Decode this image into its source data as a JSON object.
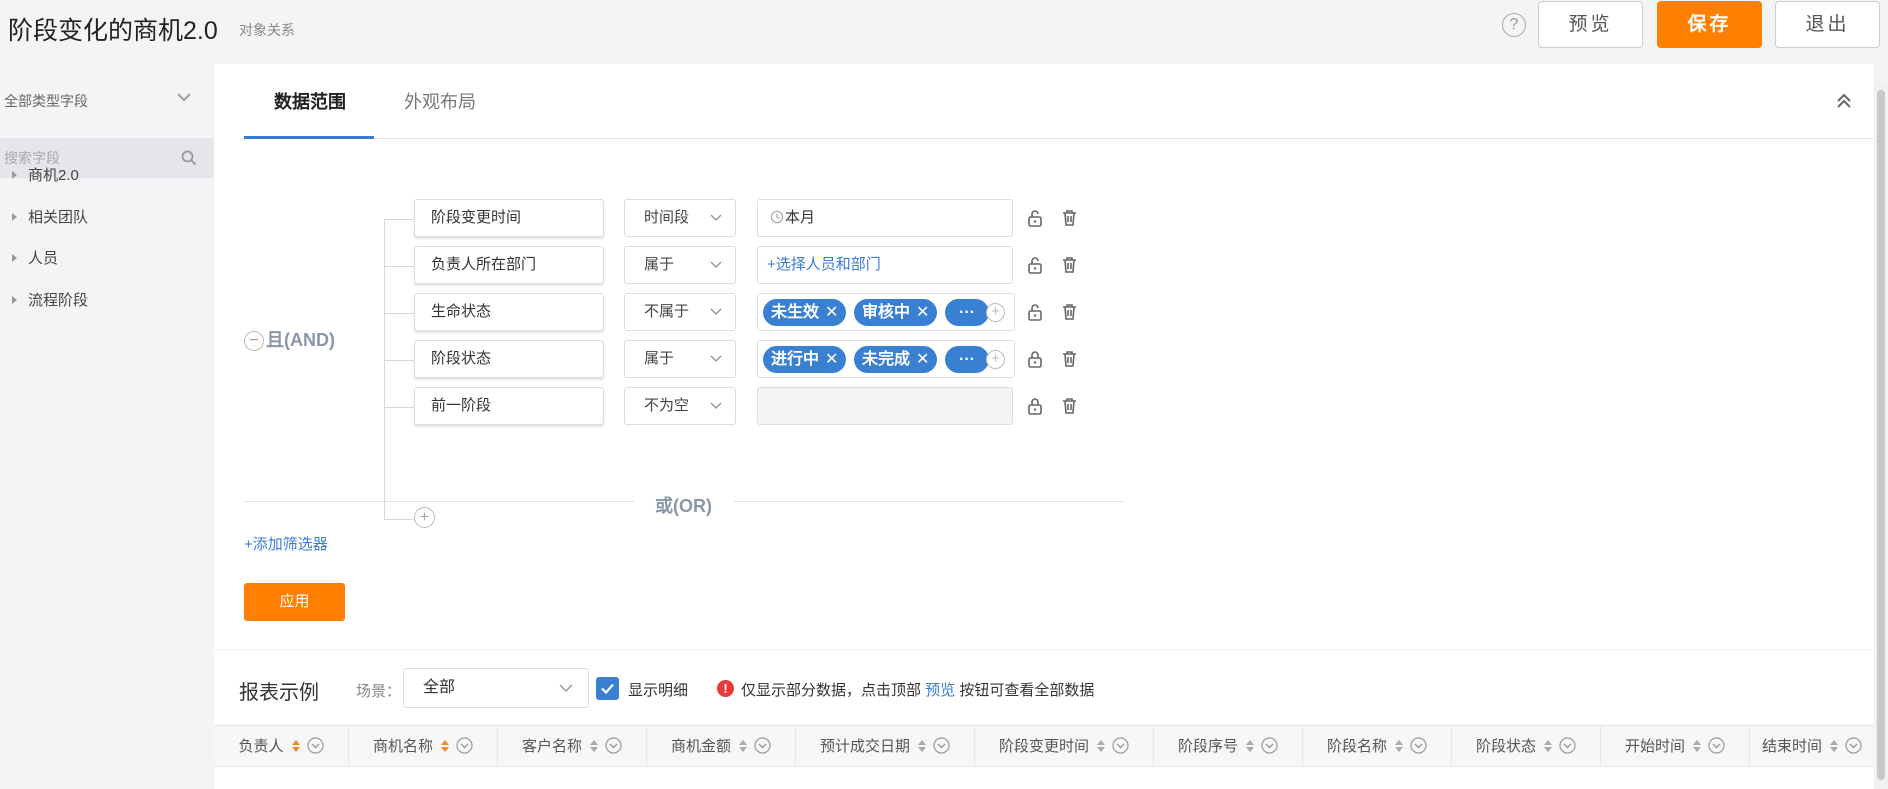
{
  "header": {
    "title": "阶段变化的商机2.0",
    "subtitle": "对象关系",
    "help_glyph": "?",
    "preview_label": "预览",
    "save_label": "保存",
    "exit_label": "退出"
  },
  "sidebar": {
    "field_type_selected": "全部类型字段",
    "search_placeholder": "搜索字段",
    "items": [
      {
        "label": "商机2.0"
      },
      {
        "label": "相关团队"
      },
      {
        "label": "人员"
      },
      {
        "label": "流程阶段"
      }
    ]
  },
  "tabs": {
    "data_range": "数据范围",
    "layout": "外观布局"
  },
  "filter": {
    "and_label": "且(AND)",
    "or_label": "或(OR)",
    "add_filter_label": "+添加筛选器",
    "apply_label": "应用",
    "conditions": [
      {
        "field": "阶段变更时间",
        "operator": "时间段",
        "value": "本月"
      },
      {
        "field": "负责人所在部门",
        "operator": "属于",
        "value": "+选择人员和部门"
      },
      {
        "field": "生命状态",
        "operator": "不属于",
        "tags": [
          "未生效",
          "审核中"
        ],
        "more": "···"
      },
      {
        "field": "阶段状态",
        "operator": "属于",
        "tags": [
          "进行中",
          "未完成"
        ],
        "more": "···"
      },
      {
        "field": "前一阶段",
        "operator": "不为空",
        "value": ""
      }
    ]
  },
  "report": {
    "title": "报表示例",
    "scene_label": "场景：",
    "scene_value": "全部",
    "show_detail_label": "显示明细",
    "show_detail_checked": true,
    "notice_prefix": "仅显示部分数据，点击顶部 ",
    "notice_link": "预览",
    "notice_suffix": " 按钮可查看全部数据",
    "columns": [
      "负责人",
      "商机名称",
      "客户名称",
      "商机金额",
      "预计成交日期",
      "阶段变更时间",
      "阶段序号",
      "阶段名称",
      "阶段状态",
      "开始时间",
      "结束时间"
    ]
  },
  "colors": {
    "accent_orange": "#ff7f00",
    "link_blue": "#3a7bd5",
    "tag_blue": "#3a80d2"
  }
}
